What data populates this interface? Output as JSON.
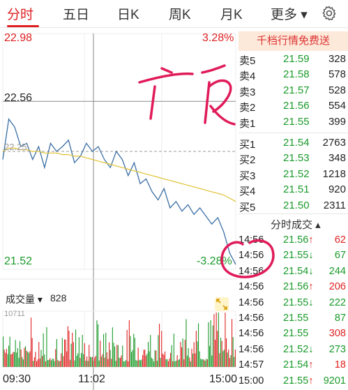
{
  "tabs": [
    {
      "label": "分时",
      "active": true
    },
    {
      "label": "五日"
    },
    {
      "label": "日K"
    },
    {
      "label": "周K"
    },
    {
      "label": "月K"
    },
    {
      "label": "更多 ▾"
    }
  ],
  "icons": {
    "settings": "gear-icon"
  },
  "colors": {
    "up": "#e02020",
    "down": "#1a9a2a",
    "avg_line": "#e0c030",
    "price_line": "#3a6ea5"
  },
  "chart": {
    "price_high": "22.98",
    "pct_high": "3.28%",
    "price_cross": "22.56",
    "price_low": "21.52",
    "pct_low": "-3.28%",
    "time_start": "09:30",
    "time_cross": "11:02",
    "time_end": "15:00",
    "avg_tag": "22.25",
    "volume_label": "成交量 ▾",
    "volume_value": "828",
    "volume_max": "10711",
    "expand_icon": "expand-icon"
  },
  "chart_data": {
    "type": "line",
    "title": "",
    "x_range": [
      "09:30",
      "15:00"
    ],
    "ylim": [
      21.52,
      22.98
    ],
    "series": [
      {
        "name": "",
        "values": [
          22.2,
          22.45,
          22.4,
          22.28,
          22.3,
          22.2,
          22.28,
          22.15,
          22.3,
          22.25,
          22.28,
          22.32,
          22.18,
          22.22,
          22.3,
          22.25,
          22.28,
          22.2,
          22.15,
          22.25,
          22.2,
          22.1,
          22.18,
          22.05,
          22.08,
          22.0,
          21.95,
          22.02,
          21.9,
          21.94,
          21.88,
          21.92,
          21.86,
          21.9,
          21.85,
          21.8,
          21.84,
          21.75,
          21.62,
          21.55
        ]
      },
      {
        "name": "",
        "values": [
          22.25,
          22.27,
          22.27,
          22.26,
          22.26,
          22.25,
          22.25,
          22.24,
          22.24,
          22.24,
          22.23,
          22.23,
          22.22,
          22.22,
          22.21,
          22.2,
          22.19,
          22.18,
          22.17,
          22.16,
          22.15,
          22.14,
          22.13,
          22.12,
          22.11,
          22.1,
          22.09,
          22.08,
          22.07,
          22.06,
          22.05,
          22.04,
          22.03,
          22.02,
          22.01,
          22.0,
          21.99,
          21.98,
          21.96,
          21.94
        ]
      }
    ],
    "volume_max": 10711,
    "volume_last": 828
  },
  "orderbook": {
    "header": "千档行情免费送",
    "asks": [
      {
        "name": "卖5",
        "price": "21.59",
        "vol": "328"
      },
      {
        "name": "卖4",
        "price": "21.58",
        "vol": "578"
      },
      {
        "name": "卖3",
        "price": "21.57",
        "vol": "528"
      },
      {
        "name": "卖2",
        "price": "21.56",
        "vol": "554"
      },
      {
        "name": "卖1",
        "price": "21.55",
        "vol": "399"
      }
    ],
    "bids": [
      {
        "name": "买1",
        "price": "21.54",
        "vol": "2763"
      },
      {
        "name": "买2",
        "price": "21.53",
        "vol": "348"
      },
      {
        "name": "买3",
        "price": "21.52",
        "vol": "1218"
      },
      {
        "name": "买4",
        "price": "21.51",
        "vol": "920"
      },
      {
        "name": "买5",
        "price": "21.50",
        "vol": "2311"
      }
    ]
  },
  "ticks": {
    "header": "分时成交 ▴",
    "rows": [
      {
        "time": "14:56",
        "price": "21.56",
        "arrow": "↑",
        "vol": "62",
        "dir": "up"
      },
      {
        "time": "14:56",
        "price": "21.55",
        "arrow": "↓",
        "vol": "67",
        "dir": "down"
      },
      {
        "time": "14:56",
        "price": "21.54",
        "arrow": "↓",
        "vol": "244",
        "dir": "down"
      },
      {
        "time": "14:56",
        "price": "21.56",
        "arrow": "↑",
        "vol": "206",
        "dir": "up"
      },
      {
        "time": "14:56",
        "price": "21.55",
        "arrow": "↓",
        "vol": "222",
        "dir": "down"
      },
      {
        "time": "14:56",
        "price": "21.55",
        "arrow": "",
        "vol": "87",
        "dir": "down"
      },
      {
        "time": "14:56",
        "price": "21.55",
        "arrow": "",
        "vol": "308",
        "dir": "up"
      },
      {
        "time": "14:56",
        "price": "21.52",
        "arrow": "↓",
        "vol": "273",
        "dir": "down"
      },
      {
        "time": "14:57",
        "price": "21.54",
        "arrow": "↑",
        "vol": "18",
        "dir": "up"
      },
      {
        "time": "15:00",
        "price": "21.55",
        "arrow": "↑",
        "vol": "9201",
        "dir": "down"
      }
    ]
  }
}
